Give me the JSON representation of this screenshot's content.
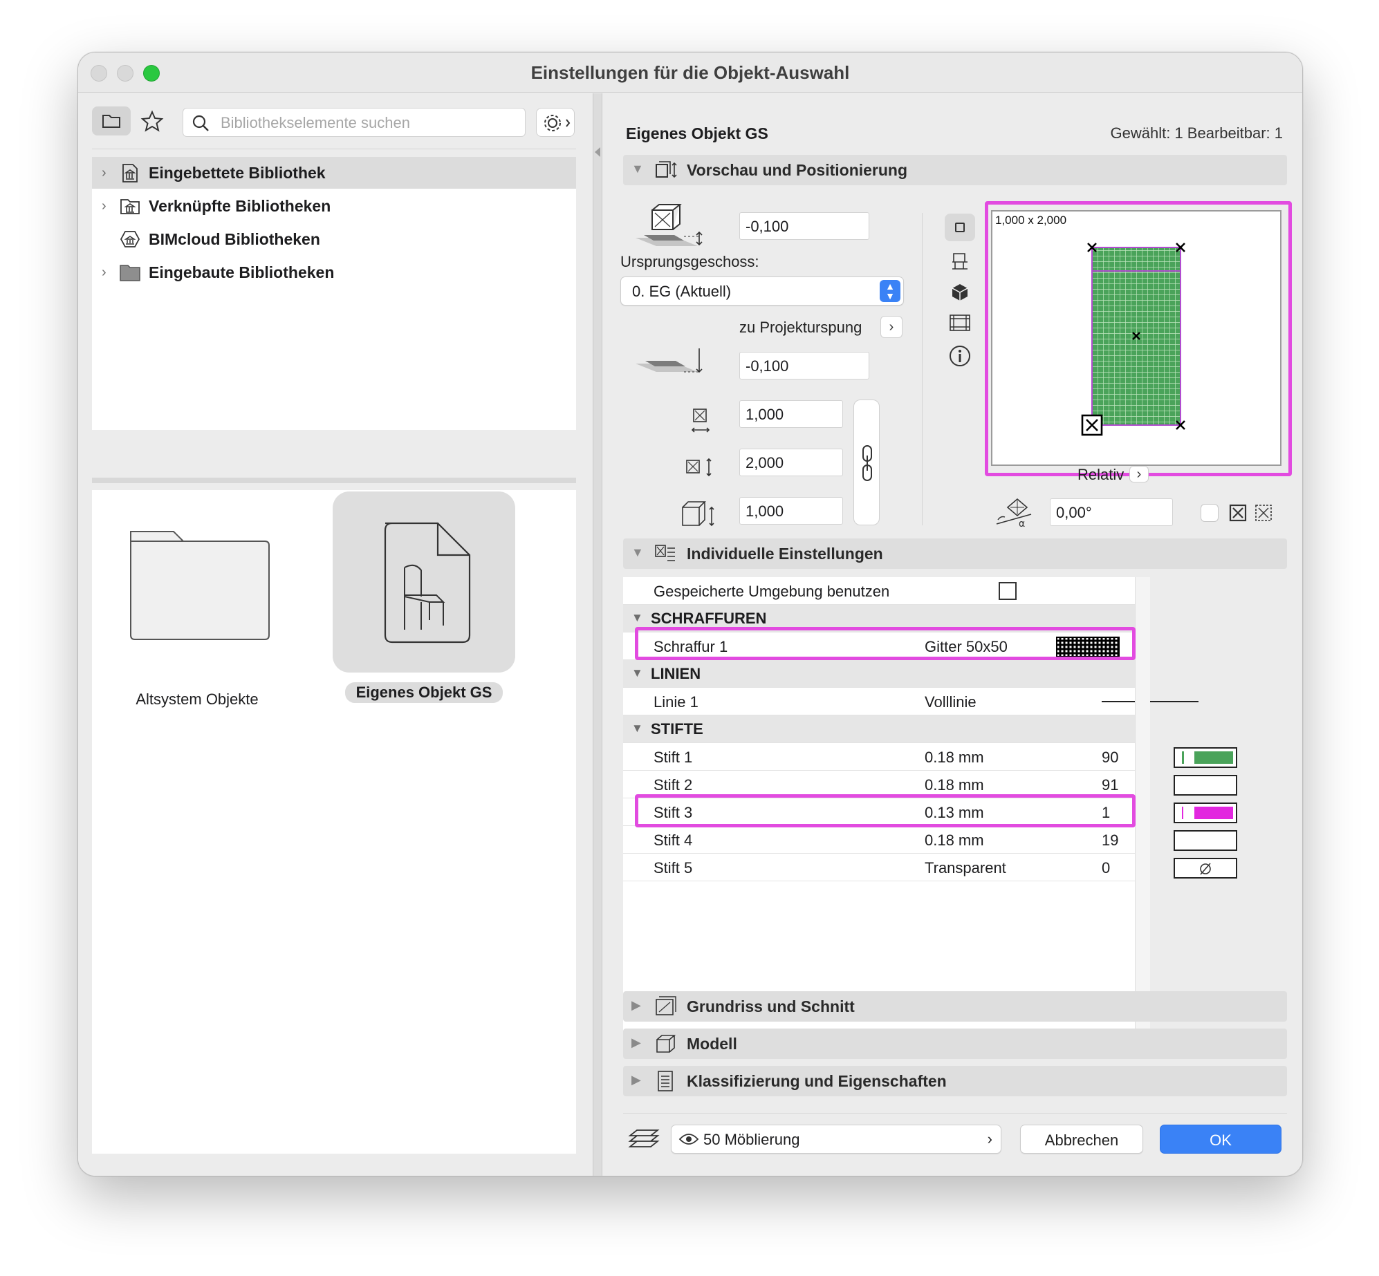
{
  "window": {
    "title": "Einstellungen für die Objekt-Auswahl"
  },
  "left": {
    "search_placeholder": "Bibliothekselemente suchen",
    "tree": [
      {
        "label": "Eingebettete Bibliothek",
        "icon": "embedded-library-icon",
        "expandable": true,
        "selected": true
      },
      {
        "label": "Verknüpfte Bibliotheken",
        "icon": "linked-library-icon",
        "expandable": true,
        "selected": false
      },
      {
        "label": "BIMcloud Bibliotheken",
        "icon": "bimcloud-library-icon",
        "expandable": false,
        "selected": false
      },
      {
        "label": "Eingebaute Bibliotheken",
        "icon": "folder-icon",
        "expandable": true,
        "selected": false
      }
    ],
    "items": [
      {
        "label": "Altsystem Objekte",
        "icon": "folder-icon"
      },
      {
        "label": "Eigenes Objekt GS",
        "icon": "chair-document-icon",
        "selected": true
      }
    ]
  },
  "right": {
    "object_name": "Eigenes Objekt GS",
    "selection_info": "Gewählt: 1 Bearbeitbar: 1",
    "preview_panel": {
      "title": "Vorschau und Positionierung",
      "offset_top": "-0,100",
      "ursprung_label": "Ursprungsgeschoss:",
      "ursprung_value": "0. EG (Aktuell)",
      "projekt_label": "zu Projekturspung",
      "offset_project": "-0,100",
      "width": "1,000",
      "depth": "2,000",
      "height": "1,000",
      "preview_size_label": "1,000 x 2,000",
      "relativ_label": "Relativ",
      "angle": "0,00°"
    },
    "settings_panel": {
      "title": "Individuelle Einstellungen",
      "gespeichert_label": "Gespeicherte Umgebung benutzen",
      "groups": {
        "schraffuren": "SCHRAFFUREN",
        "linien": "LINIEN",
        "stifte": "STIFTE"
      },
      "schraffur": {
        "name": "Schraffur 1",
        "value": "Gitter 50x50"
      },
      "linie": {
        "name": "Linie 1",
        "value": "Volllinie"
      },
      "stifte": [
        {
          "name": "Stift 1",
          "weight": "0.18 mm",
          "index": "90",
          "color": "#4aa35a"
        },
        {
          "name": "Stift 2",
          "weight": "0.18 mm",
          "index": "91",
          "color": "#ffffff"
        },
        {
          "name": "Stift 3",
          "weight": "0.13 mm",
          "index": "1",
          "color": "#e227df"
        },
        {
          "name": "Stift 4",
          "weight": "0.18 mm",
          "index": "19",
          "color": "#ffffff"
        },
        {
          "name": "Stift 5",
          "weight": "Transparent",
          "index": "0",
          "color": "none"
        }
      ]
    },
    "collapsed_panels": [
      {
        "title": "Grundriss und Schnitt",
        "icon": "floorplan-section-icon"
      },
      {
        "title": "Modell",
        "icon": "model-cube-icon"
      },
      {
        "title": "Klassifizierung und Eigenschaften",
        "icon": "document-list-icon"
      }
    ],
    "footer": {
      "layer": "50 Möblierung",
      "cancel": "Abbrechen",
      "ok": "OK"
    }
  },
  "colors": {
    "accent": "#3a82f6",
    "highlight": "#e24be0",
    "hatch_green": "#4aa35a"
  }
}
